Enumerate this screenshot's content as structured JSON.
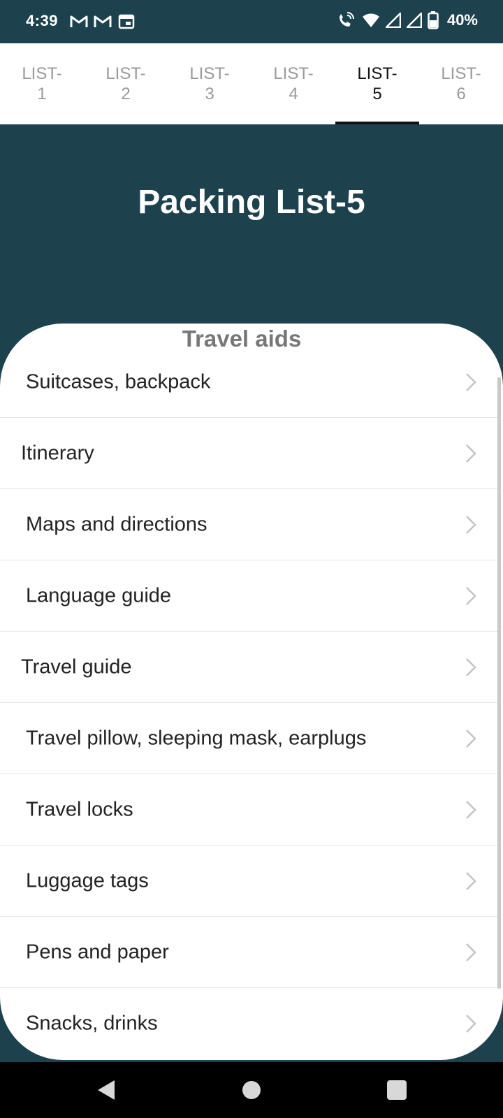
{
  "status_bar": {
    "time": "4:39",
    "battery": "40%",
    "left_icons": [
      "gmail-icon",
      "gmail-icon",
      "calendar-icon"
    ],
    "right_icons": [
      "wifi-calling-icon",
      "wifi-icon",
      "signal-icon",
      "signal-icon",
      "battery-icon"
    ]
  },
  "tabs": [
    {
      "label": "LIST-1",
      "active": false
    },
    {
      "label": "LIST-2",
      "active": false
    },
    {
      "label": "LIST-3",
      "active": false
    },
    {
      "label": "LIST-4",
      "active": false
    },
    {
      "label": "LIST-5",
      "active": true
    },
    {
      "label": "LIST-6",
      "active": false
    }
  ],
  "header": {
    "title": "Packing List-5"
  },
  "section": {
    "title": "Travel aids",
    "items": [
      {
        "label": "Suitcases, backpack"
      },
      {
        "label": "Itinerary"
      },
      {
        "label": "Maps and directions"
      },
      {
        "label": "Language guide"
      },
      {
        "label": "Travel guide"
      },
      {
        "label": "Travel pillow, sleeping mask, earplugs"
      },
      {
        "label": "Travel locks"
      },
      {
        "label": "Luggage tags"
      },
      {
        "label": "Pens and paper"
      },
      {
        "label": "Snacks, drinks"
      }
    ]
  },
  "nav_bar": {
    "buttons": [
      "back-icon",
      "home-icon",
      "recents-icon"
    ]
  },
  "colors": {
    "primary": "#1d424d",
    "card": "#ffffff",
    "tab_active": "#111111",
    "tab_inactive": "#9a9a9a"
  }
}
